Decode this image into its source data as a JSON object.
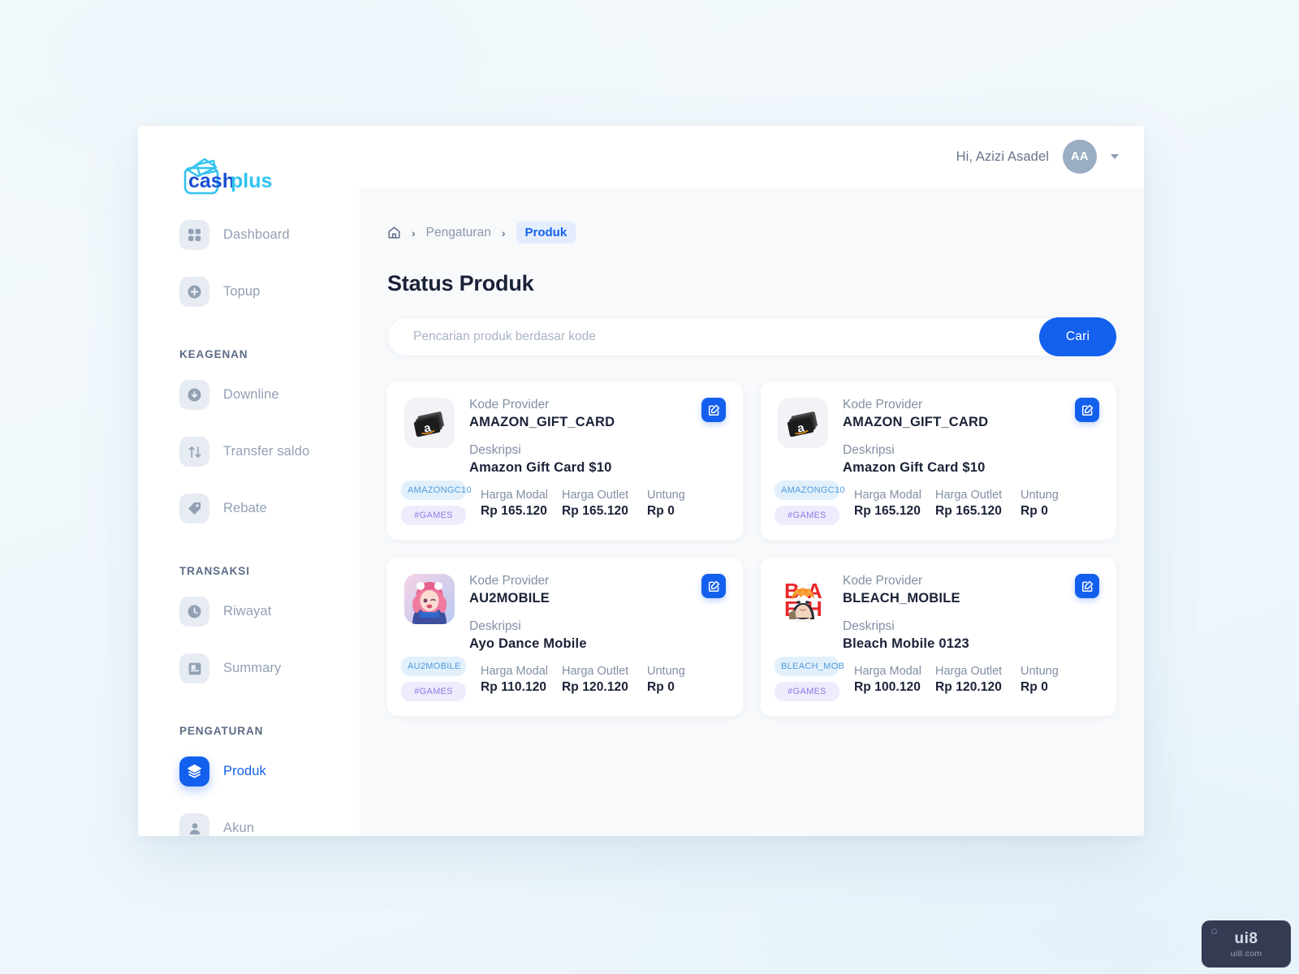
{
  "brand": {
    "name_dark": "cash",
    "name_light": "plus",
    "color_dark": "#1a4fd6",
    "color_light": "#2fc4f0"
  },
  "topbar": {
    "greeting": "Hi, Azizi Asadel",
    "avatar_initials": "AA"
  },
  "sidebar": {
    "primary": [
      {
        "label": "Dashboard",
        "icon": "grid-icon",
        "active": false
      },
      {
        "label": "Topup",
        "icon": "plus-circle-icon",
        "active": false
      }
    ],
    "sections": [
      {
        "title": "KEAGENAN",
        "items": [
          {
            "label": "Downline",
            "icon": "download-circle-icon",
            "active": false
          },
          {
            "label": "Transfer saldo",
            "icon": "transfer-arrows-icon",
            "active": false
          },
          {
            "label": "Rebate",
            "icon": "tag-icon",
            "active": false
          }
        ]
      },
      {
        "title": "TRANSAKSI",
        "items": [
          {
            "label": "Riwayat",
            "icon": "clock-icon",
            "active": false
          },
          {
            "label": "Summary",
            "icon": "book-icon",
            "active": false
          }
        ]
      },
      {
        "title": "PENGATURAN",
        "items": [
          {
            "label": "Produk",
            "icon": "layers-icon",
            "active": true
          },
          {
            "label": "Akun",
            "icon": "user-icon",
            "active": false
          }
        ]
      }
    ]
  },
  "breadcrumb": {
    "home_icon": "home-icon",
    "separator": "›",
    "parent": "Pengaturan",
    "current": "Produk"
  },
  "page": {
    "title": "Status Produk"
  },
  "search": {
    "placeholder": "Pencarian produk berdasar kode",
    "value": "",
    "button_label": "Cari"
  },
  "table_labels": {
    "kode_provider": "Kode Provider",
    "deskripsi": "Deskripsi",
    "harga_modal": "Harga Modal",
    "harga_outlet": "Harga Outlet",
    "untung": "Untung"
  },
  "products": [
    {
      "thumb": "amazon-gift-card-icon",
      "kode_provider": "AMAZON_GIFT_CARD",
      "deskripsi": "Amazon Gift Card $10",
      "chip_code": "AMAZONGC10",
      "chip_tag": "#GAMES",
      "harga_modal": "Rp 165.120",
      "harga_outlet": "Rp 165.120",
      "untung": "Rp 0",
      "edit_icon": "edit-square-icon"
    },
    {
      "thumb": "amazon-gift-card-icon",
      "kode_provider": "AMAZON_GIFT_CARD",
      "deskripsi": "Amazon Gift Card $10",
      "chip_code": "AMAZONGC10",
      "chip_tag": "#GAMES",
      "harga_modal": "Rp 165.120",
      "harga_outlet": "Rp 165.120",
      "untung": "Rp 0",
      "edit_icon": "edit-square-icon"
    },
    {
      "thumb": "ayodance-game-icon",
      "kode_provider": "AU2MOBILE",
      "deskripsi": "Ayo Dance Mobile",
      "chip_code": "AU2MOBILE",
      "chip_tag": "#GAMES",
      "harga_modal": "Rp 110.120",
      "harga_outlet": "Rp 120.120",
      "untung": "Rp 0",
      "edit_icon": "edit-square-icon"
    },
    {
      "thumb": "bleach-game-icon",
      "kode_provider": "BLEACH_MOBILE",
      "deskripsi": "Bleach Mobile 0123",
      "chip_code": "BLEACH_MOB",
      "chip_tag": "#GAMES",
      "harga_modal": "Rp 100.120",
      "harga_outlet": "Rp 120.120",
      "untung": "Rp 0",
      "edit_icon": "edit-square-icon"
    }
  ],
  "watermark": {
    "main": "ui8",
    "sub": "ui8.com"
  },
  "colors": {
    "accent": "#1460ee",
    "chip_code_bg": "#e2f0fb",
    "chip_code_text": "#4f9be0",
    "chip_tag_bg": "#eeecfc",
    "chip_tag_text": "#8b7ae8",
    "page_bg": "#f7f9fb"
  }
}
